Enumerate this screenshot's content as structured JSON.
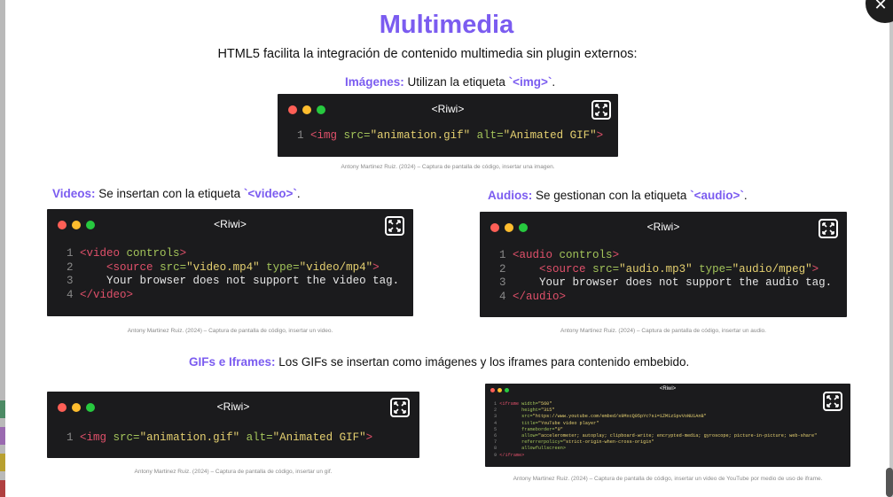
{
  "page": {
    "title": "Multimedia",
    "subtitle": "HTML5 facilita la integración de contenido multimedia sin plugin externos:"
  },
  "images": {
    "keyword": "Imágenes:",
    "text": " Utilizan la etiqueta ",
    "tag": "`<img>`",
    "end": ".",
    "window_title": "<Riwi>",
    "code_line_number": "1",
    "code": {
      "open": "<img ",
      "a1": "src=",
      "v1": "\"animation.gif\"",
      "a2": " alt=",
      "v2": "\"Animated GIF\"",
      "close": ">"
    },
    "caption": "Antony Martinez Ruiz. (2024) – Captura de pantalla de código, insertar una imagen."
  },
  "videos": {
    "keyword": "Videos:",
    "text": " Se insertan con la etiqueta ",
    "tag": "`<video>`",
    "end": ".",
    "window_title": "<Riwi>",
    "lines": {
      "l1": {
        "n": "1",
        "tag": "<video",
        "attr": " controls",
        "close": ">"
      },
      "l2": {
        "n": "2",
        "indent": "    ",
        "tag": "<source",
        "a1": " src=",
        "v1": "\"video.mp4\"",
        "a2": " type=",
        "v2": "\"video/mp4\"",
        "close": ">"
      },
      "l3": {
        "n": "3",
        "text": "    Your browser does not support the video tag."
      },
      "l4": {
        "n": "4",
        "tag": "</video>"
      }
    },
    "caption": "Antony Martinez Ruiz. (2024) – Captura de pantalla de código, insertar un video."
  },
  "audios": {
    "keyword": "Audios:",
    "text": " Se gestionan con la etiqueta ",
    "tag": "`<audio>`",
    "end": ".",
    "window_title": "<Riwi>",
    "lines": {
      "l1": {
        "n": "1",
        "tag": "<audio",
        "attr": " controls",
        "close": ">"
      },
      "l2": {
        "n": "2",
        "indent": "    ",
        "tag": "<source",
        "a1": " src=",
        "v1": "\"audio.mp3\"",
        "a2": " type=",
        "v2": "\"audio/mpeg\"",
        "close": ">"
      },
      "l3": {
        "n": "3",
        "text": "    Your browser does not support the audio tag."
      },
      "l4": {
        "n": "4",
        "tag": "</audio>"
      }
    },
    "caption": "Antony Martinez Ruiz. (2024) – Captura de pantalla de código, insertar un audio."
  },
  "gifs": {
    "keyword": "GIFs e Iframes:",
    "text": " Los GIFs se insertan como imágenes y los iframes para contenido embebido.",
    "window_title": "<Riwi>",
    "code_line_number": "1",
    "code": {
      "open": "<img ",
      "a1": "src=",
      "v1": "\"animation.gif\"",
      "a2": " alt=",
      "v2": "\"Animated GIF\"",
      "close": ">"
    },
    "caption": "Antony Martinez Ruiz. (2024) – Captura de pantalla de código, insertar un gif."
  },
  "iframe": {
    "window_title": "<Riwi>",
    "lines": [
      {
        "n": "1",
        "tag": "<iframe",
        "attr": " width=",
        "val": "\"560\""
      },
      {
        "n": "2",
        "tag": "",
        "attr": "        height=",
        "val": "\"315\""
      },
      {
        "n": "3",
        "tag": "",
        "attr": "        src=",
        "val": "\"https://www.youtube.com/embed/s9MxcQ95pYc?si=1ZM1zSpvVoNU1AnB\""
      },
      {
        "n": "4",
        "tag": "",
        "attr": "        title=",
        "val": "\"YouTube video player\""
      },
      {
        "n": "5",
        "tag": "",
        "attr": "        frameborder=",
        "val": "\"0\""
      },
      {
        "n": "6",
        "tag": "",
        "attr": "        allow=",
        "val": "\"accelerometer; autoplay; clipboard-write; encrypted-media; gyroscope; picture-in-picture; web-share\""
      },
      {
        "n": "7",
        "tag": "",
        "attr": "        referrerpolicy=",
        "val": "\"strict-origin-when-cross-origin\""
      },
      {
        "n": "8",
        "tag": "",
        "attr": "        allowfullscreen>",
        "val": ""
      },
      {
        "n": "9",
        "tag": "</iframe>",
        "attr": "",
        "val": ""
      }
    ],
    "caption": "Antony Martinez Ruiz. (2024) – Captura de pantalla de código, insertar un video de YouTube por medio de uso de iframe."
  },
  "controls": {
    "close_icon": "close-icon",
    "expand_icon": "expand-icon",
    "close_glyph": "✕"
  }
}
